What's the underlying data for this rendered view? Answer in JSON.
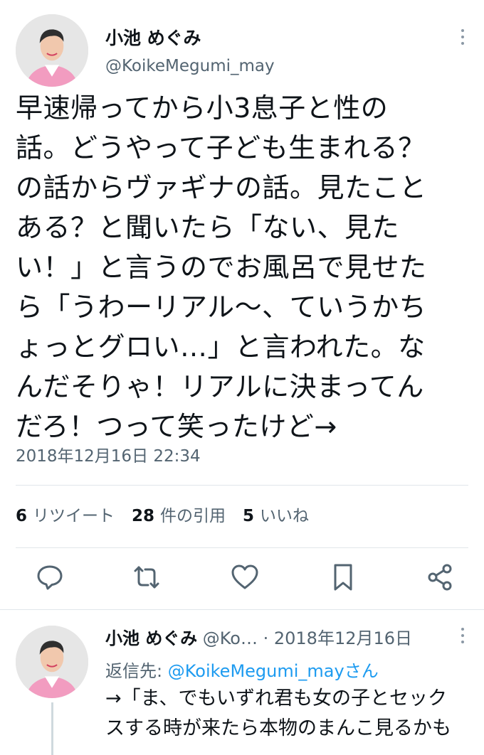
{
  "tweet": {
    "author_name": "小池 めぐみ",
    "handle": "@KoikeMegumi_may",
    "text": "早速帰ってから小3息子と性の\n話。どうやって子ども生まれる？\nの話からヴァギナの話。見たこと\nある？と聞いたら「ない、見た\nい！」と言うのでお風呂で見せた\nら「うわーリアル〜、ていうかち\nょっとグロい…」と言われた。な\nんだそりゃ！リアルに決まってん\nだろ！つって笑ったけど→",
    "timestamp": "2018年12月16日 22:34",
    "stats": {
      "retweets_count": "6",
      "retweets_label": "リツイート",
      "quotes_count": "28",
      "quotes_label": "件の引用",
      "likes_count": "5",
      "likes_label": "いいね"
    },
    "icons": [
      "reply-icon",
      "retweet-icon",
      "like-icon",
      "bookmark-icon",
      "share-icon"
    ]
  },
  "reply": {
    "author_name": "小池 めぐみ",
    "handle": "@Ko…",
    "separator": "·",
    "date": "2018年12月16日",
    "replying_label": "返信先:",
    "replying_handle": "@KoikeMegumi_mayさん",
    "text": "→「ま、でもいずれ君も女の子とセック\nスする時が来たら本物のまんこ見るかも"
  },
  "colors": {
    "text": "#0f1419",
    "secondary": "#536471",
    "link": "#1d9bf0",
    "divider": "#e1e6ea"
  }
}
